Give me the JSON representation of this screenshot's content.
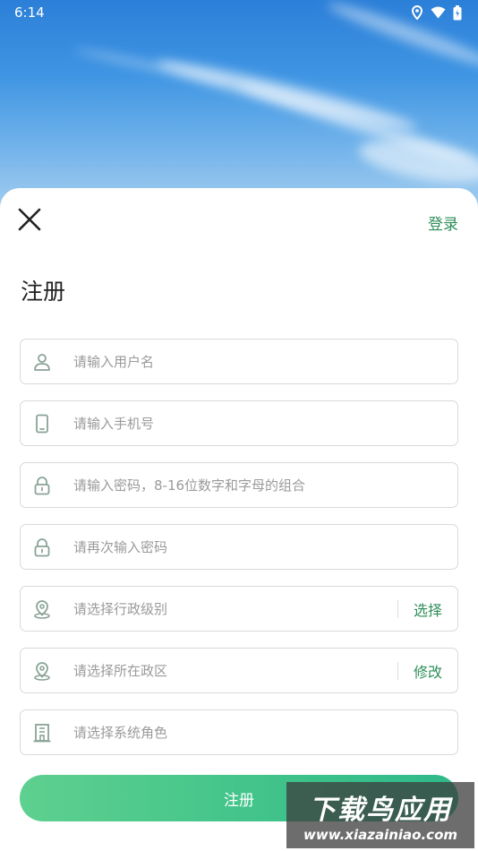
{
  "status_bar": {
    "time": "6:14"
  },
  "header": {
    "login_label": "登录",
    "title": "注册"
  },
  "form": {
    "fields": [
      {
        "icon": "user-icon",
        "placeholder": "请输入用户名",
        "value": ""
      },
      {
        "icon": "phone-icon",
        "placeholder": "请输入手机号",
        "value": ""
      },
      {
        "icon": "lock-icon",
        "placeholder": "请输入密码，8-16位数字和字母的组合",
        "value": ""
      },
      {
        "icon": "lock-icon",
        "placeholder": "请再次输入密码",
        "value": ""
      },
      {
        "icon": "location-icon",
        "placeholder": "请选择行政级别",
        "value": "",
        "action": "选择"
      },
      {
        "icon": "location-icon",
        "placeholder": "请选择所在政区",
        "value": "",
        "action": "修改"
      },
      {
        "icon": "building-icon",
        "placeholder": "请选择系统角色",
        "value": ""
      }
    ],
    "submit_label": "注册"
  },
  "watermark": {
    "title": "下载鸟应用",
    "url": "www.xiazainiao.com"
  },
  "colors": {
    "accent": "#2f8f5a",
    "button_start": "#5ed08f",
    "button_end": "#2fb98a"
  }
}
